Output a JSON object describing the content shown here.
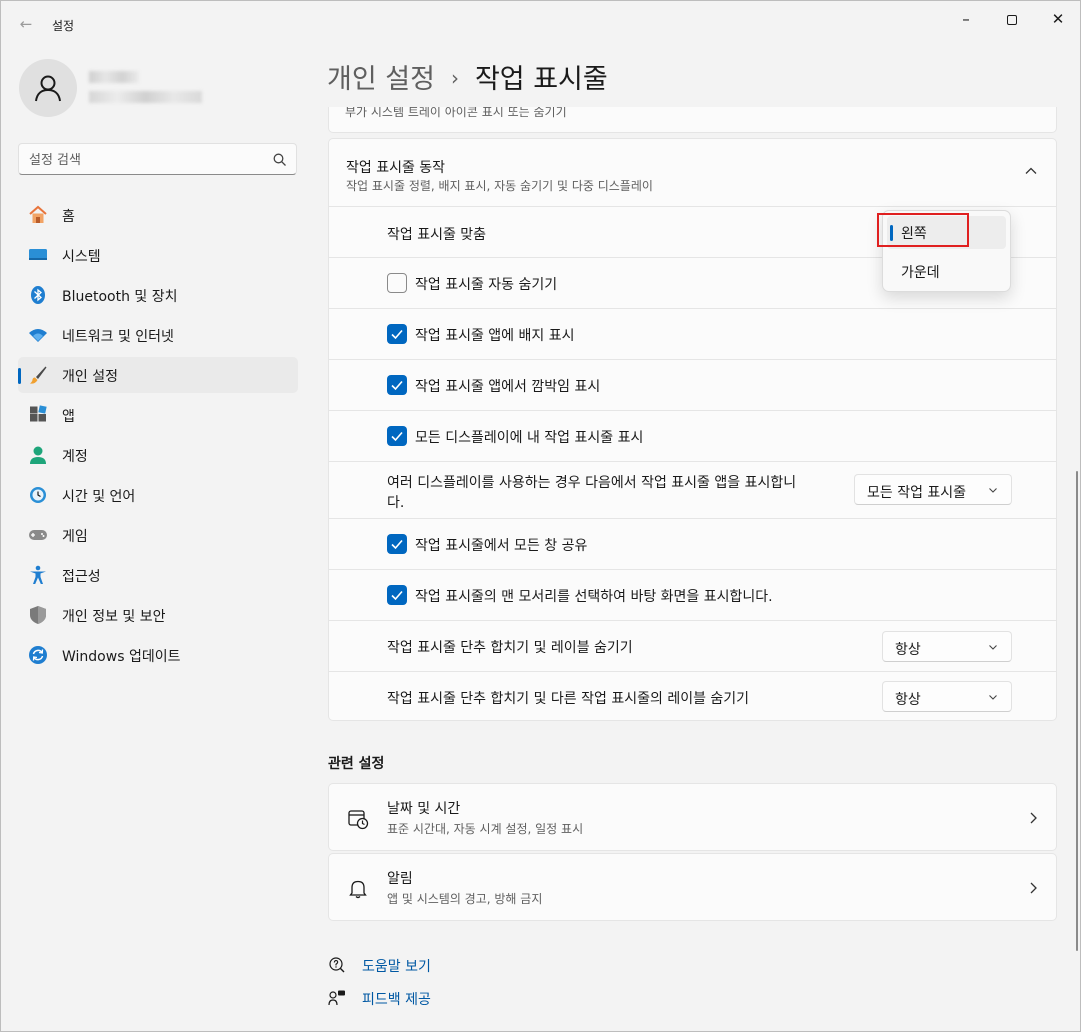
{
  "window": {
    "title": "설정"
  },
  "search": {
    "placeholder": "설정 검색"
  },
  "sidebar": {
    "items": [
      {
        "label": "홈",
        "icon": "home-icon"
      },
      {
        "label": "시스템",
        "icon": "system-icon"
      },
      {
        "label": "Bluetooth 및 장치",
        "icon": "bluetooth-icon"
      },
      {
        "label": "네트워크 및 인터넷",
        "icon": "wifi-icon"
      },
      {
        "label": "개인 설정",
        "icon": "brush-icon",
        "active": true
      },
      {
        "label": "앱",
        "icon": "apps-icon"
      },
      {
        "label": "계정",
        "icon": "account-icon"
      },
      {
        "label": "시간 및 언어",
        "icon": "time-language-icon"
      },
      {
        "label": "게임",
        "icon": "gamepad-icon"
      },
      {
        "label": "접근성",
        "icon": "accessibility-icon"
      },
      {
        "label": "개인 정보 및 보안",
        "icon": "shield-icon"
      },
      {
        "label": "Windows 업데이트",
        "icon": "update-icon"
      }
    ]
  },
  "breadcrumb": {
    "parent": "개인 설정",
    "separator": "›",
    "current": "작업 표시줄"
  },
  "top_card": {
    "text": "부가 시스템 트레이 아이콘 표시 또는 숨기기"
  },
  "behaviours": {
    "title": "작업 표시줄 동작",
    "subtitle": "작업 표시줄 정렬, 배지 표시, 자동 숨기기 및 다중 디스플레이",
    "alignment_label": "작업 표시줄 맞춤",
    "auto_hide": {
      "label": "작업 표시줄 자동 숨기기",
      "checked": false
    },
    "badges": {
      "label": "작업 표시줄 앱에 배지 표시",
      "checked": true
    },
    "flashing": {
      "label": "작업 표시줄 앱에서 깜박임 표시",
      "checked": true
    },
    "all_displays": {
      "label": "모든 디스플레이에 내 작업 표시줄 표시",
      "checked": true
    },
    "multi_display": {
      "label_line1": "여러 디스플레이를 사용하는 경우 다음에서 작업 표시줄 앱을 표시합니",
      "label_line2": "다.",
      "value": "모든 작업 표시줄"
    },
    "share_window": {
      "label": "작업 표시줄에서 모든 창 공유",
      "checked": true
    },
    "far_corner": {
      "label": "작업 표시줄의 맨 모서리를 선택하여 바탕 화면을 표시합니다.",
      "checked": true
    },
    "combine_buttons": {
      "label": "작업 표시줄 단추 합치기 및 레이블 숨기기",
      "value": "항상"
    },
    "combine_other": {
      "label": "작업 표시줄 단추 합치기 및 다른 작업 표시줄의 레이블 숨기기",
      "value": "항상"
    }
  },
  "alignment_menu": {
    "options": [
      "왼쪽",
      "가운데"
    ],
    "selected": "왼쪽",
    "highlight_color": "#e02020"
  },
  "related": {
    "title": "관련 설정",
    "items": [
      {
        "title": "날짜 및 시간",
        "subtitle": "표준 시간대, 자동 시계 설정, 일정 표시",
        "icon": "calendar-clock-icon"
      },
      {
        "title": "알림",
        "subtitle": "앱 및 시스템의 경고, 방해 금지",
        "icon": "bell-icon"
      }
    ]
  },
  "links": {
    "help": "도움말 보기",
    "feedback": "피드백 제공"
  },
  "colors": {
    "accent": "#0067c0",
    "background": "#f3f3f3",
    "card": "#fbfbfb"
  }
}
